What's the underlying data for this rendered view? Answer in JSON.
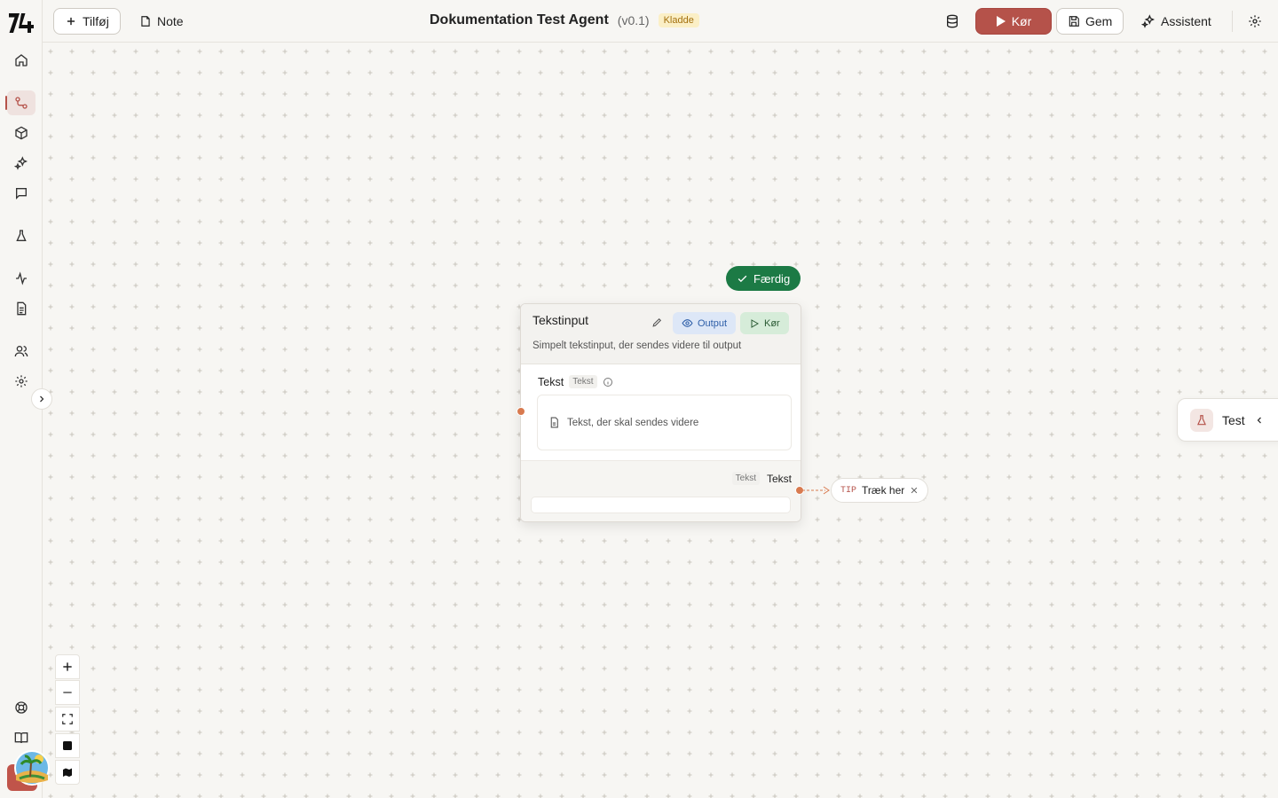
{
  "header": {
    "add_label": "Tilføj",
    "note_label": "Note",
    "title": "Dokumentation Test Agent",
    "version": "(v0.1)",
    "status_badge": "Kladde",
    "run_label": "Kør",
    "save_label": "Gem",
    "assistant_label": "Assistent"
  },
  "node": {
    "status": "Færdig",
    "title": "Tekstinput",
    "description": "Simpelt tekstinput, der sendes videre til output",
    "output_btn": "Output",
    "run_btn": "Kør",
    "field_label": "Tekst",
    "field_type": "Tekst",
    "input_placeholder": "Tekst, der skal sendes videre",
    "output_type": "Tekst",
    "output_label": "Tekst"
  },
  "tip": {
    "tag": "TIP",
    "text": "Træk her"
  },
  "test_panel": {
    "label": "Test"
  },
  "sidebar": {
    "items": [
      "home-icon",
      "workflow-icon",
      "box-icon",
      "sparkles-icon",
      "chat-icon",
      "flask-icon",
      "activity-icon",
      "document-icon",
      "users-icon",
      "settings-icon"
    ],
    "bottom": [
      "help-icon",
      "book-icon"
    ]
  },
  "colors": {
    "accent": "#b5524a",
    "success": "#1c7a45",
    "canvas": "#f7f6f3"
  }
}
